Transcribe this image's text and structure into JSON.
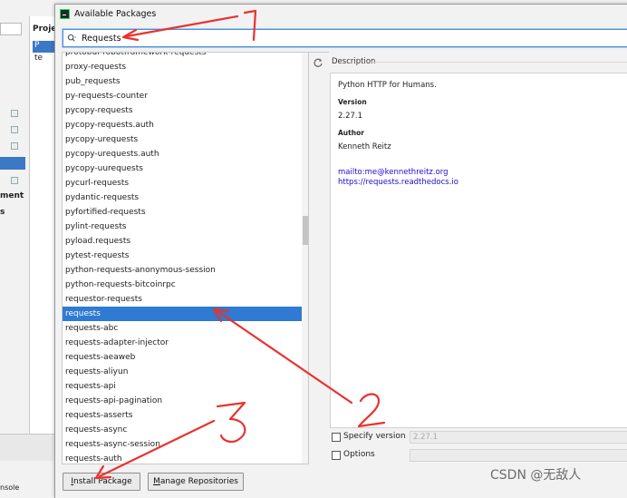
{
  "background": {
    "project_label": "Proje",
    "project_item_selected": "P",
    "project_item": "te",
    "side_fragment_1": "ment",
    "side_fragment_2": "s",
    "console_fragment": "nsole"
  },
  "dialog": {
    "title": "Available Packages"
  },
  "search": {
    "value": "Requests"
  },
  "packages": [
    "protobuf-robotframework-requests",
    "proxy-requests",
    "pub_requests",
    "py-requests-counter",
    "pycopy-requests",
    "pycopy-requests.auth",
    "pycopy-urequests",
    "pycopy-urequests.auth",
    "pycopy-uurequests",
    "pycurl-requests",
    "pydantic-requests",
    "pyfortified-requests",
    "pylint-requests",
    "pyload.requests",
    "pytest-requests",
    "python-requests-anonymous-session",
    "python-requests-bitcoinrpc",
    "requestor-requests",
    "requests",
    "requests-abc",
    "requests-adapter-injector",
    "requests-aeaweb",
    "requests-aliyun",
    "requests-api",
    "requests-api-pagination",
    "requests-asserts",
    "requests-async",
    "requests-async-session",
    "requests-auth"
  ],
  "selected_package": "requests",
  "description": {
    "header": "Description",
    "summary": "Python HTTP for Humans.",
    "version_label": "Version",
    "version": "2.27.1",
    "author_label": "Author",
    "author": "Kenneth Reitz",
    "email_link": "mailto:me@kennethreitz.org",
    "docs_link": "https://requests.readthedocs.io"
  },
  "options": {
    "specify_version_label": "Specify version",
    "specify_version_value": "2.27.1",
    "options_label": "Options"
  },
  "buttons": {
    "install_prefix": "I",
    "install_rest": "nstall Package",
    "manage_prefix": "M",
    "manage_rest": "anage Repositories"
  },
  "annotations": {
    "mark_1": "1",
    "mark_2": "2",
    "mark_3": "3",
    "color": "#e8332f"
  },
  "watermark": "CSDN @无敌人",
  "colors": {
    "selection": "#2f7ad2",
    "focus_border": "#4a90d9",
    "link": "#1a0dcc"
  }
}
